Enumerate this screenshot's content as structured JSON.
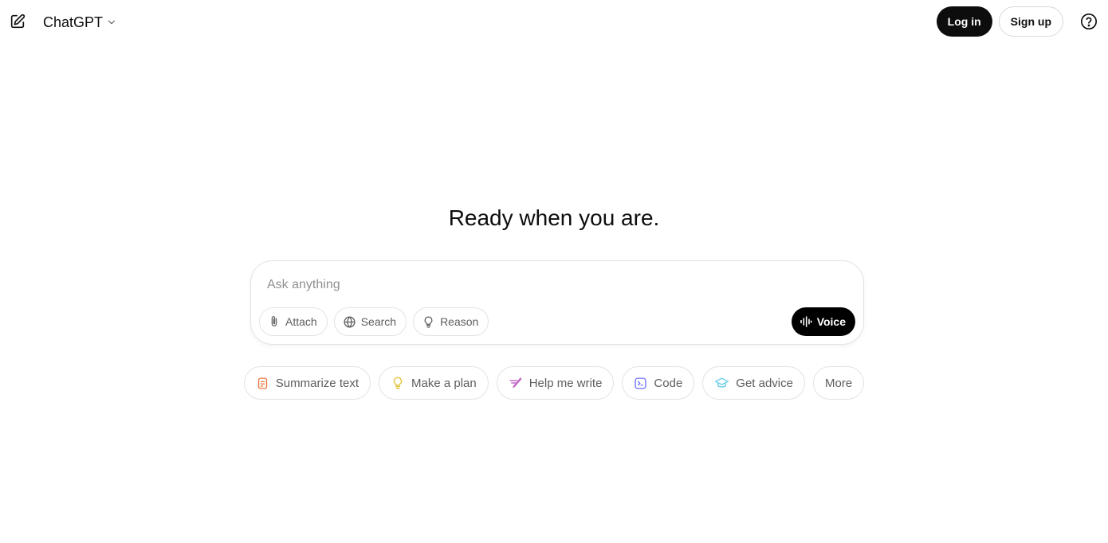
{
  "header": {
    "model_name": "ChatGPT",
    "login_label": "Log in",
    "signup_label": "Sign up"
  },
  "main": {
    "headline": "Ready when you are."
  },
  "composer": {
    "placeholder": "Ask anything",
    "value": "",
    "tools": [
      {
        "label": "Attach",
        "icon": "paperclip-icon"
      },
      {
        "label": "Search",
        "icon": "globe-icon"
      },
      {
        "label": "Reason",
        "icon": "lightbulb-icon"
      }
    ],
    "voice_label": "Voice"
  },
  "suggestions": [
    {
      "label": "Summarize text",
      "icon": "document-icon",
      "color": "#e8773f"
    },
    {
      "label": "Make a plan",
      "icon": "lightbulb-icon",
      "color": "#e2c541"
    },
    {
      "label": "Help me write",
      "icon": "pen-icon",
      "color": "#c46ec7"
    },
    {
      "label": "Code",
      "icon": "terminal-icon",
      "color": "#6c71ff"
    },
    {
      "label": "Get advice",
      "icon": "graduation-cap-icon",
      "color": "#76d0eb"
    },
    {
      "label": "More",
      "icon": "",
      "color": ""
    }
  ],
  "colors": {
    "primary_button": "#0d0d0d",
    "border": "#e3e3e3",
    "muted_text": "#5d5d5d"
  }
}
